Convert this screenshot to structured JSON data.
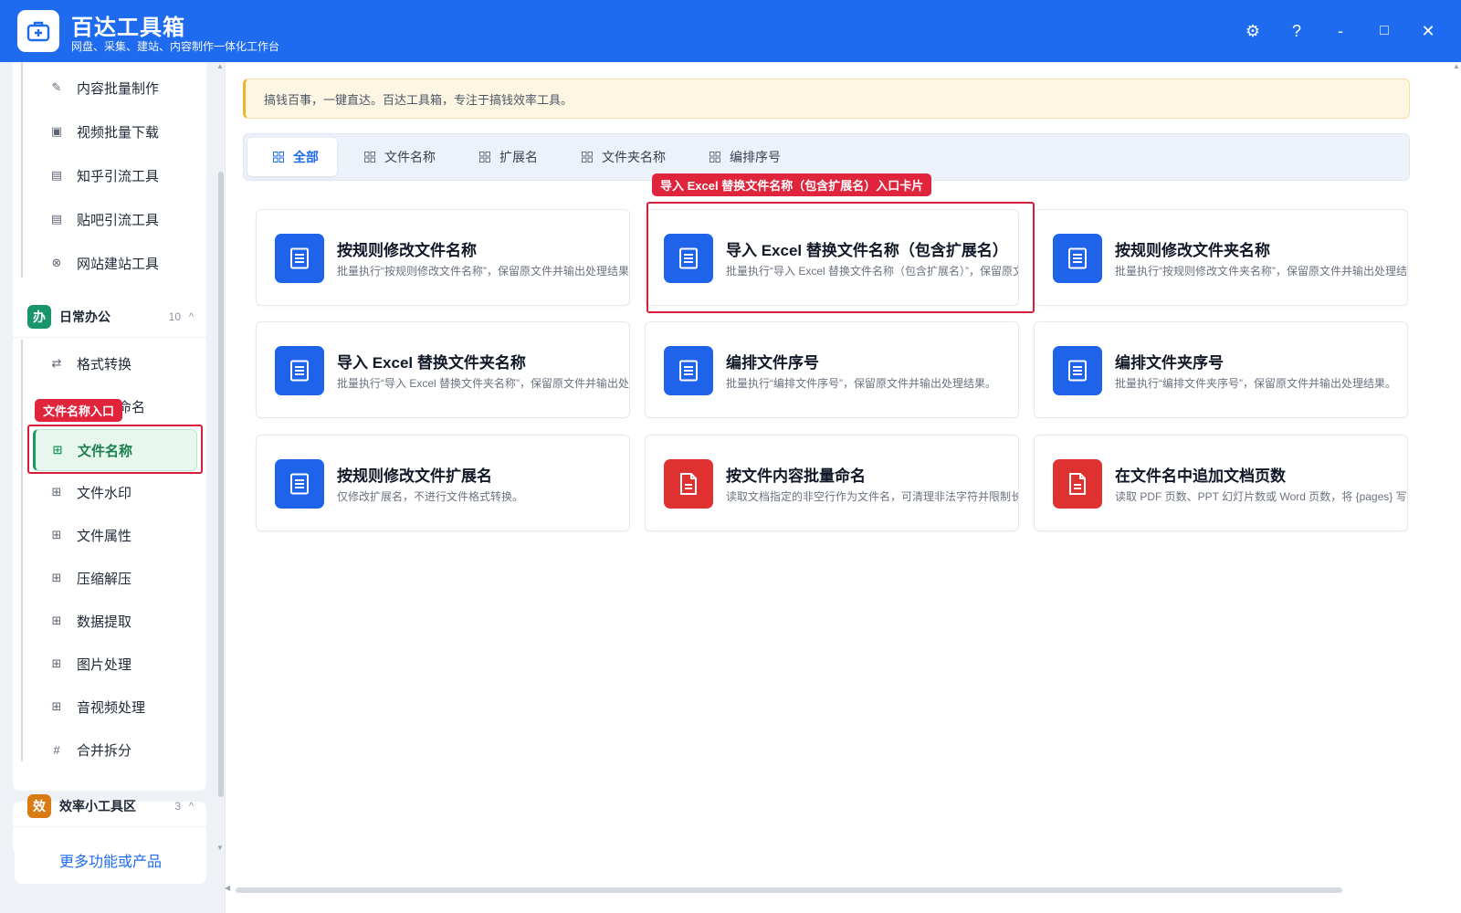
{
  "app": {
    "title": "百达工具箱",
    "subtitle": "网盘、采集、建站、内容制作一体化工作台"
  },
  "window_controls": {
    "settings": "⚙",
    "help": "?",
    "minimize": "-",
    "maximize": "□",
    "close": "✕"
  },
  "sidebar": {
    "top_items": [
      {
        "label": "内容批量制作",
        "icon": "pencil-icon"
      },
      {
        "label": "视频批量下载",
        "icon": "video-icon"
      },
      {
        "label": "知乎引流工具",
        "icon": "zhihu-icon"
      },
      {
        "label": "贴吧引流工具",
        "icon": "tieba-icon"
      },
      {
        "label": "网站建站工具",
        "icon": "globe-icon"
      }
    ],
    "group_daily": {
      "badge": "办",
      "title": "日常办公",
      "count": "10",
      "caret": "^",
      "color": "#18956a",
      "items": [
        {
          "label": "格式转换",
          "icon": "swap-icon"
        },
        {
          "label": "文件重命名",
          "icon": "grid-icon"
        },
        {
          "label": "文件名称",
          "icon": "grid-icon"
        },
        {
          "label": "文件水印",
          "icon": "grid-icon"
        },
        {
          "label": "文件属性",
          "icon": "grid-icon"
        },
        {
          "label": "压缩解压",
          "icon": "grid-icon"
        },
        {
          "label": "数据提取",
          "icon": "grid-icon"
        },
        {
          "label": "图片处理",
          "icon": "grid-icon"
        },
        {
          "label": "音视频处理",
          "icon": "grid-icon"
        },
        {
          "label": "合并拆分",
          "icon": "hash-icon"
        }
      ]
    },
    "group_efficiency": {
      "badge": "效",
      "title": "效率小工具区",
      "count": "3",
      "caret": "^",
      "color": "#d97a12"
    },
    "more_button": "更多功能或产品"
  },
  "annotations": {
    "sidebar_callout": "文件名称入口",
    "card_callout": "导入 Excel 替换文件名称（包含扩展名）入口卡片"
  },
  "main": {
    "notice": "搞钱百事，一键直达。百达工具箱，专注于搞钱效率工具。",
    "tabs": [
      {
        "label": "全部",
        "active": true
      },
      {
        "label": "文件名称",
        "active": false
      },
      {
        "label": "扩展名",
        "active": false
      },
      {
        "label": "文件夹名称",
        "active": false
      },
      {
        "label": "编排序号",
        "active": false
      }
    ],
    "cards": [
      {
        "title": "按规则修改文件名称",
        "desc": "批量执行“按规则修改文件名称”，保留原文件并输出处理结果。",
        "color": "#1e63e9"
      },
      {
        "title": "导入 Excel 替换文件名称（包含扩展名）",
        "desc": "批量执行“导入 Excel 替换文件名称（包含扩展名）”，保留原文件并输出处理结果。",
        "color": "#1e63e9"
      },
      {
        "title": "按规则修改文件夹名称",
        "desc": "批量执行“按规则修改文件夹名称”，保留原文件并输出处理结果。",
        "color": "#1e63e9"
      },
      {
        "title": "导入 Excel 替换文件夹名称",
        "desc": "批量执行“导入 Excel 替换文件夹名称”，保留原文件并输出处理结果。",
        "color": "#1e63e9"
      },
      {
        "title": "编排文件序号",
        "desc": "批量执行“编排文件序号”，保留原文件并输出处理结果。",
        "color": "#1e63e9"
      },
      {
        "title": "编排文件夹序号",
        "desc": "批量执行“编排文件夹序号”，保留原文件并输出处理结果。",
        "color": "#1e63e9"
      },
      {
        "title": "按规则修改文件扩展名",
        "desc": "仅修改扩展名，不进行文件格式转换。",
        "color": "#1e63e9"
      },
      {
        "title": "按文件内容批量命名",
        "desc": "读取文档指定的非空行作为文件名，可清理非法字符并限制长度；",
        "color": "#e03131"
      },
      {
        "title": "在文件名中追加文档页数",
        "desc": "读取 PDF 页数、PPT 幻灯片数或 Word 页数，将 {pages} 写入命名规则。",
        "color": "#e03131"
      }
    ]
  }
}
